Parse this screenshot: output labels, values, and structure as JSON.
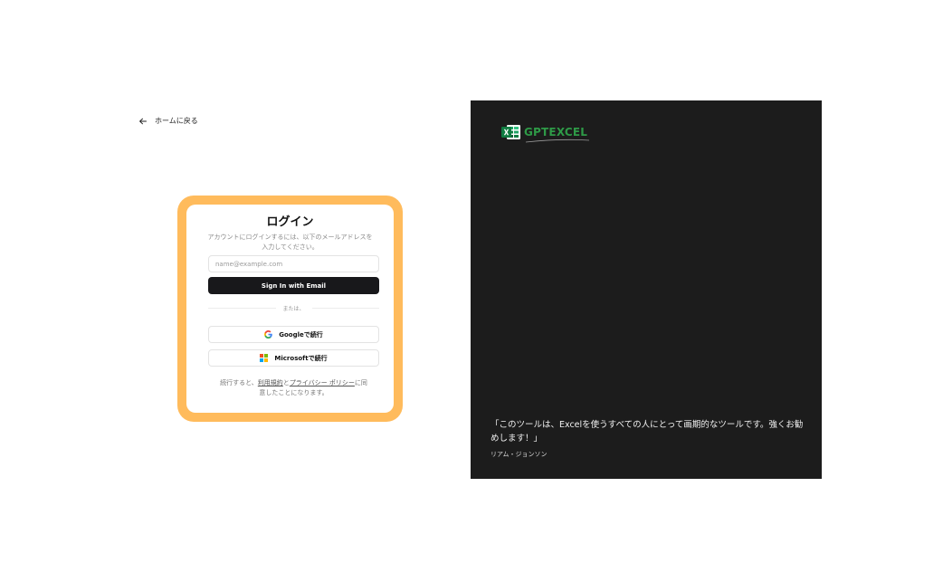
{
  "nav": {
    "back_label": "ホームに戻る"
  },
  "login": {
    "title": "ログイン",
    "subtitle": "アカウントにログインするには、以下のメールアドレスを入力してください。",
    "email_placeholder": "name@example.com",
    "email_value": "",
    "signin_label": "Sign In with Email",
    "divider_label": "または、",
    "google_label": "Googleで続行",
    "microsoft_label": "Microsoftで続行",
    "terms_prefix": "続行すると、",
    "terms_link": "利用規約",
    "terms_and": "と",
    "privacy_link": "プライバシー ポリシー",
    "terms_suffix": "に同意したことになります。"
  },
  "brand": {
    "name": "GPTEXCEL",
    "icon": "excel-icon"
  },
  "testimonial": {
    "quote": "「このツールは、Excelを使うすべての人にとって画期的なツールです。強くお勧めします！」",
    "author": "リアム・ジョンソン"
  },
  "colors": {
    "highlight_frame": "#ffbb5c",
    "primary_button": "#18181b",
    "panel_background": "#1c1c1c",
    "brand_green": "#2e9a47"
  }
}
